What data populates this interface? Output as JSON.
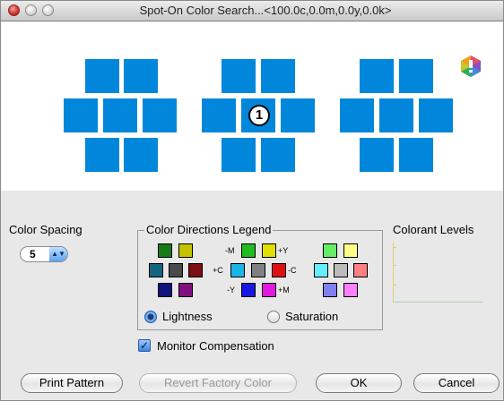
{
  "window": {
    "title": "Spot-On Color Search...<100.0c,0.0m,0.0y,0.0k>",
    "accent_color": "#0087db"
  },
  "preview": {
    "selected_badge": "1",
    "gamut_icon": "gamut-warning-icon"
  },
  "color_spacing": {
    "label": "Color Spacing",
    "value": "5"
  },
  "legend": {
    "title": "Color Directions Legend",
    "labels": {
      "minus_m": "-M",
      "plus_y": "+Y",
      "plus_c": "+C",
      "minus_c": "-C",
      "minus_y": "-Y",
      "plus_m": "+M"
    },
    "left_swatches": [
      "#177a17",
      "#c3c300",
      "#12657f",
      "#4a4a4a",
      "#7d0f12",
      "#12127f",
      "#7f107f"
    ],
    "center_swatches": [
      "#22bb22",
      "#e0e000",
      "#1ab4e6",
      "#808080",
      "#e01010",
      "#1818e0",
      "#e018e0"
    ],
    "right_swatches": [
      "#66ee66",
      "#ffff88",
      "#66eeff",
      "#bbbbbb",
      "#ff8080",
      "#8080ee",
      "#ff80ff"
    ],
    "lightness_label": "Lightness",
    "saturation_label": "Saturation",
    "selected_mode": "Lightness"
  },
  "colorant_levels": {
    "label": "Colorant Levels"
  },
  "monitor_compensation": {
    "label": "Monitor Compensation",
    "checked": true
  },
  "buttons": {
    "print_pattern": "Print Pattern",
    "revert_factory": "Revert Factory Color",
    "ok": "OK",
    "cancel": "Cancel"
  }
}
